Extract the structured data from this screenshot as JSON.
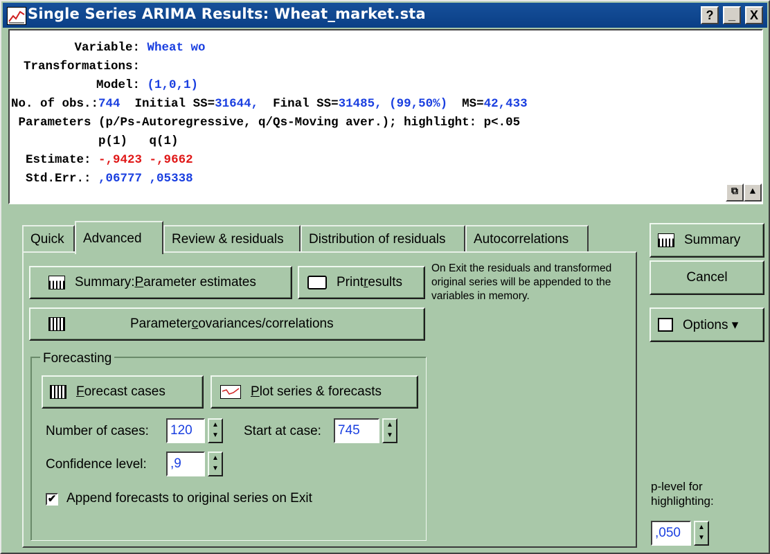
{
  "window": {
    "title": "Single Series ARIMA Results: Wheat_market.sta",
    "help_btn": "?",
    "min_btn": "_",
    "close_btn": "X"
  },
  "output": {
    "var_label": "       Variable:",
    "var_value": "Wheat wo",
    "trans_label": "Transformations:",
    "model_label": "          Model:",
    "model_value": "(1,0,1)",
    "obs_label": "No. of obs.:",
    "obs_value": "744",
    "init_label": "  Initial SS=",
    "init_value": "31644,",
    "final_label": "  Final SS=",
    "final_value": "31485, (99,50%)",
    "ms_label": "  MS=",
    "ms_value": "42,433",
    "params_line": " Parameters (p/Ps-Autoregressive, q/Qs-Moving aver.); highlight: p<.05",
    "param_header": "            p(1)   q(1)",
    "est_label": "  Estimate:",
    "est_values": "-,9423 -,9662",
    "se_label": "  Std.Err.:",
    "se_values": ",06777 ,05338"
  },
  "tabs": [
    {
      "label": "Quick"
    },
    {
      "label": "Advanced"
    },
    {
      "label": "Review & residuals"
    },
    {
      "label": "Distribution of residuals"
    },
    {
      "label": "Autocorrelations"
    }
  ],
  "advanced": {
    "summary_param_btn": {
      "pre": "Summary:  ",
      "ul": "P",
      "post": "arameter estimates"
    },
    "print_btn": {
      "pre": "Print ",
      "ul": "r",
      "post": "esults"
    },
    "covariances_btn": {
      "pre": "Parameter ",
      "ul": "c",
      "post": "ovariances/correlations"
    },
    "note": "On Exit the residuals and transformed original series will be appended to the variables in memory.",
    "forecasting": {
      "group_label": "Forecasting",
      "forecast_btn": {
        "pre": "",
        "ul": "F",
        "post": "orecast cases"
      },
      "plot_btn": {
        "pre": "",
        "ul": "P",
        "post": "lot series & forecasts"
      },
      "num_cases_label": "Number of cases:",
      "num_cases_value": "120",
      "start_label": "Start at case:",
      "start_value": "745",
      "conf_label": "Confidence level:",
      "conf_value": ",9",
      "append_checked": "✔",
      "append_label": "Append forecasts to original series on Exit"
    }
  },
  "right": {
    "summary_btn": "Summary",
    "cancel_btn": "Cancel",
    "options_btn": "Options ▾",
    "plevel_label": "p-level for highlighting:",
    "plevel_value": ",050"
  },
  "icons": {
    "spin_up": "▲",
    "spin_down": "▼",
    "restore": "⧉",
    "expand": "▲"
  },
  "colors": {
    "background": "#a9c8a9",
    "titlebar": "#16509a",
    "value_blue": "#1a3fe0",
    "value_red": "#e01818"
  }
}
